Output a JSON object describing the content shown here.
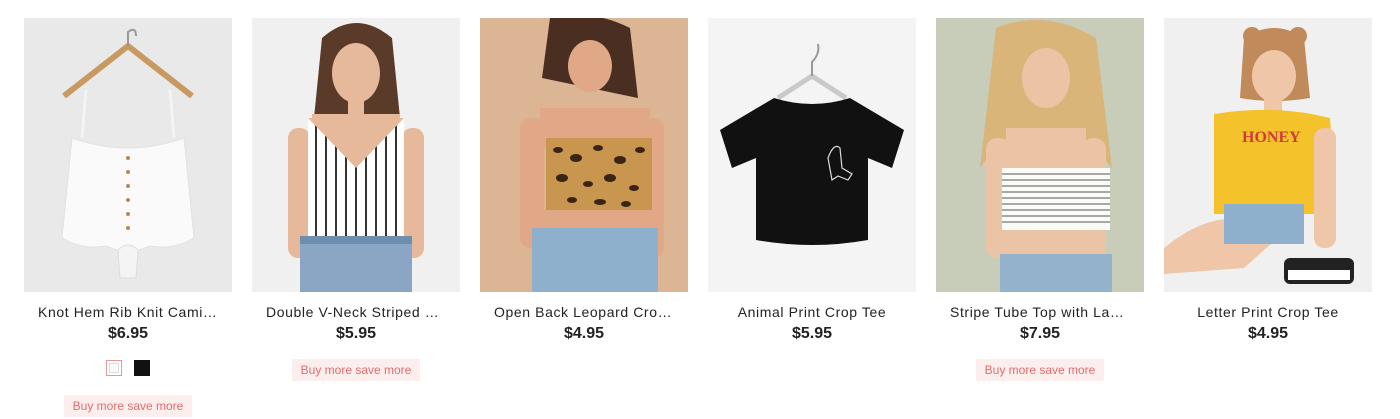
{
  "products": [
    {
      "title": "Knot Hem Rib Knit Cami ...",
      "price": "$6.95",
      "promo": "Buy more save more",
      "swatches": [
        "white",
        "black"
      ]
    },
    {
      "title": "Double V-Neck Striped C...",
      "price": "$5.95",
      "promo": "Buy more save more"
    },
    {
      "title": "Open Back Leopard Crop...",
      "price": "$4.95"
    },
    {
      "title": "Animal Print Crop Tee",
      "price": "$5.95"
    },
    {
      "title": "Stripe Tube Top with Lac...",
      "price": "$7.95",
      "promo": "Buy more save more"
    },
    {
      "title": "Letter Print Crop Tee",
      "price": "$4.95",
      "graphic_text": "HONEY"
    }
  ],
  "colors": {
    "promo_bg": "#fdeeee",
    "promo_text": "#e06e6e",
    "swatch_selected_border": "#e49a9a"
  }
}
